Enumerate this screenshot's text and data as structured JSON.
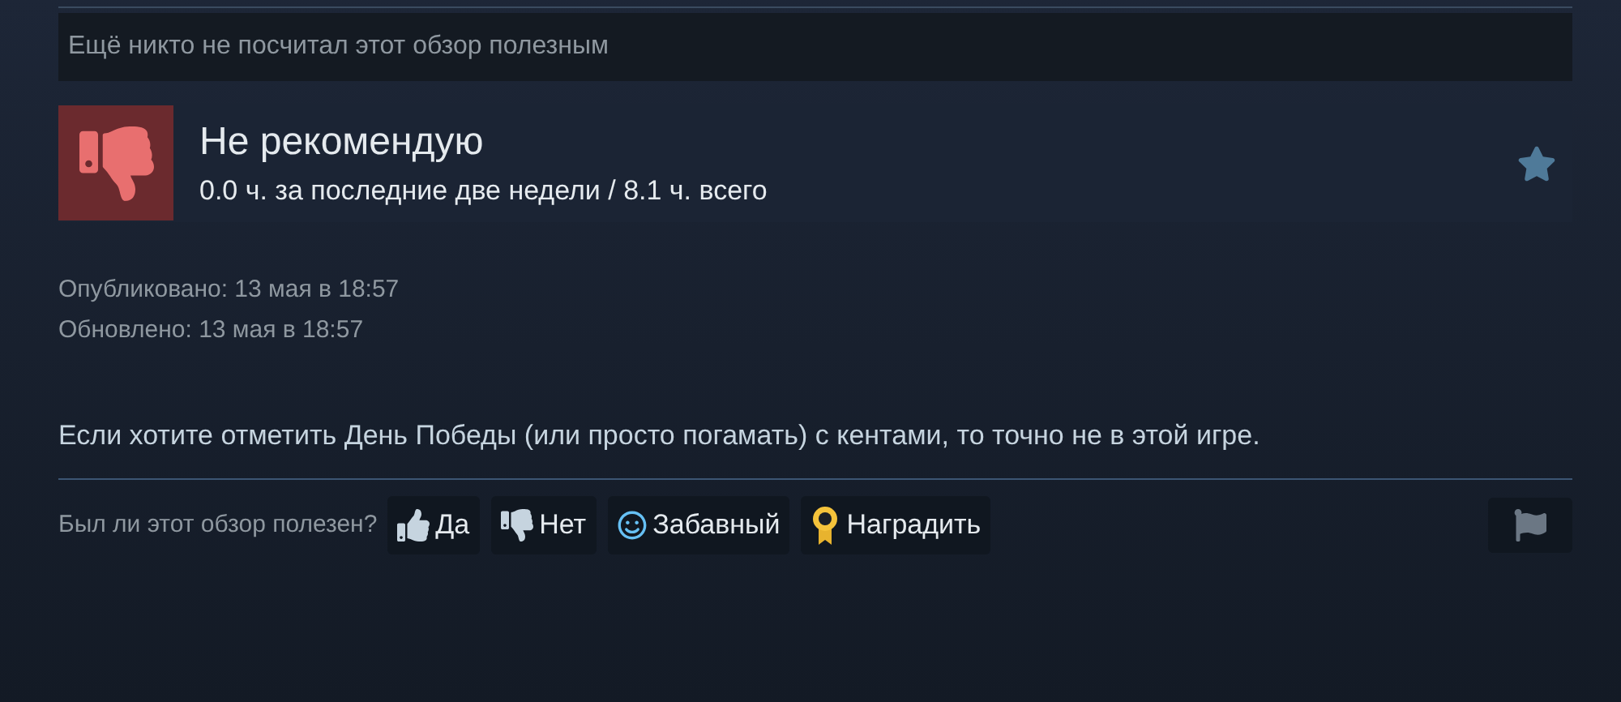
{
  "helpful_banner": "Ещё никто не посчитал этот обзор полезным",
  "review": {
    "verdict": "Не рекомендую",
    "recommended": false,
    "hours": "0.0 ч. за последние две недели / 8.1 ч. всего"
  },
  "dates": [
    "Опубликовано: 13 мая в 18:57",
    "Обновлено: 13 мая в 18:57"
  ],
  "body": "Если хотите отметить День Победы (или просто погамать) с кентами, то точно не в этой игре.",
  "vote": {
    "question": "Был ли этот обзор полезен?",
    "buttons": [
      {
        "kind": "thumbs-up",
        "label": "Да"
      },
      {
        "kind": "thumbs-down",
        "label": "Нет"
      },
      {
        "kind": "smiley",
        "label": "Забавный"
      },
      {
        "kind": "award",
        "label": "Наградить"
      }
    ]
  }
}
